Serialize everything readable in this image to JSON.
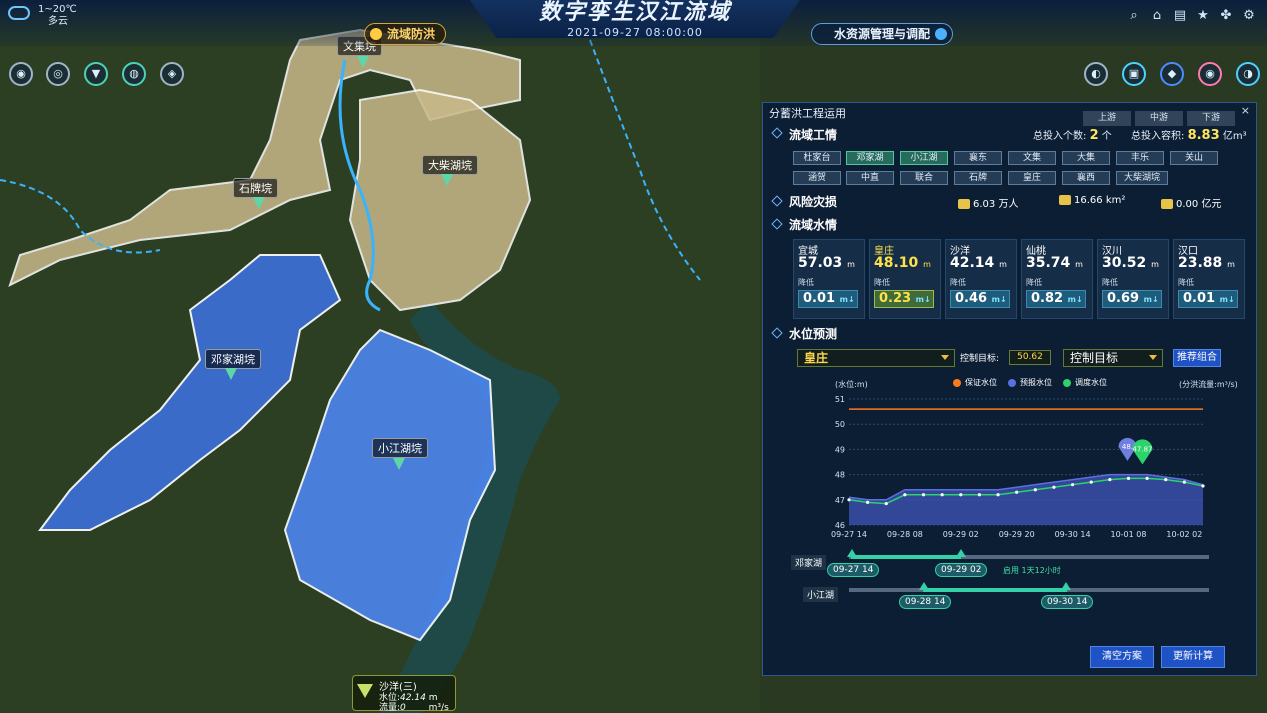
{
  "header": {
    "title": "数字孪生汉江流域",
    "datetime": "2021-09-27  08:00:00",
    "mode_left": "流域防洪",
    "mode_right": "水资源管理与调配"
  },
  "weather": {
    "temp": "1~20℃",
    "desc": "多云"
  },
  "top_icons": [
    "search-icon",
    "home-icon",
    "document-icon",
    "star-icon",
    "grid-icon",
    "gear-icon"
  ],
  "map": {
    "labels": [
      "文集垸",
      "大柴湖垸",
      "石牌垸",
      "邓家湖垸",
      "小江湖垸"
    ],
    "station": {
      "name": "沙洋(三)",
      "level_label": "水位:",
      "level": "42.14",
      "level_unit": "m",
      "flow_label": "流量:",
      "flow": "0",
      "flow_unit": "m³/s"
    }
  },
  "panel": {
    "title": "分蓄洪工程运用",
    "close": "×",
    "segments": [
      "上游",
      "中游",
      "下游"
    ],
    "sec1": {
      "title": "流域工情",
      "count_label": "总投入个数:",
      "count": "2",
      "count_unit": "个",
      "vol_label": "总投入容积:",
      "vol": "8.83",
      "vol_unit": "亿m³"
    },
    "chips": [
      "杜家台",
      "邓家湖",
      "小江湖",
      "襄东",
      "文集",
      "大集",
      "丰乐",
      "关山",
      "涵贺",
      "中直",
      "联合",
      "石牌",
      "皇庄",
      "襄西",
      "大柴湖垸"
    ],
    "sec2": {
      "title": "风险灾损",
      "pop": "6.03",
      "pop_unit": "万人",
      "area": "16.66",
      "area_unit": "km²",
      "loss": "0.00",
      "loss_unit": "亿元"
    },
    "sec3": {
      "title": "流域水情"
    },
    "stations": [
      {
        "name": "宜城",
        "level": "57.03",
        "unit": "m",
        "trend": "降低",
        "delta": "0.01"
      },
      {
        "name": "皇庄",
        "level": "48.10",
        "unit": "m",
        "trend": "降低",
        "delta": "0.23"
      },
      {
        "name": "沙洋",
        "level": "42.14",
        "unit": "m",
        "trend": "降低",
        "delta": "0.46"
      },
      {
        "name": "仙桃",
        "level": "35.74",
        "unit": "m",
        "trend": "降低",
        "delta": "0.82"
      },
      {
        "name": "汉川",
        "level": "30.52",
        "unit": "m",
        "trend": "降低",
        "delta": "0.69"
      },
      {
        "name": "汉口",
        "level": "23.88",
        "unit": "m",
        "trend": "降低",
        "delta": "0.01"
      }
    ],
    "sec4": {
      "title": "水位预测",
      "station_select": "皇庄",
      "ctl_label": "控制目标:",
      "ctl_value": "50.62",
      "target_select": "控制目标",
      "recommend": "推荐组合"
    },
    "legend": [
      "保证水位",
      "预报水位",
      "调度水位"
    ],
    "chart_labels": {
      "ylabel": "(水位:m)",
      "y2label": "(分洪流量:m³/s)",
      "pin1": "48.",
      "pin2": "47.87"
    },
    "gantt": [
      {
        "name": "邓家湖",
        "start": "09-27 14",
        "end": "09-29 02",
        "note": "启用 1天12小时"
      },
      {
        "name": "小江湖",
        "start": "09-28 14",
        "end": "09-30 14",
        "note": ""
      }
    ],
    "buttons": {
      "clear": "清空方案",
      "recalc": "更新计算"
    }
  },
  "chart_data": {
    "type": "line",
    "x": [
      "09-27 14",
      "09-27 20",
      "09-28 02",
      "09-28 08",
      "09-28 14",
      "09-28 20",
      "09-29 02",
      "09-29 08",
      "09-29 14",
      "09-29 20",
      "09-30 02",
      "09-30 08",
      "09-30 14",
      "09-30 20",
      "10-01 02",
      "10-01 08",
      "10-01 14",
      "10-01 20",
      "10-02 02",
      "10-02 08"
    ],
    "xticks": [
      "09-27 14",
      "09-28 08",
      "09-29 02",
      "09-29 20",
      "09-30 14",
      "10-01 08",
      "10-02 02"
    ],
    "ylim": [
      46,
      51
    ],
    "yticks": [
      46,
      47,
      48,
      49,
      50,
      51
    ],
    "ylabel": "(水位:m)",
    "series": [
      {
        "name": "保证水位",
        "color": "#ff7a1a",
        "values": [
          50.6,
          50.6,
          50.6,
          50.6,
          50.6,
          50.6,
          50.6,
          50.6,
          50.6,
          50.6,
          50.6,
          50.6,
          50.6,
          50.6,
          50.6,
          50.6,
          50.6,
          50.6,
          50.6,
          50.6
        ]
      },
      {
        "name": "预报水位",
        "color": "#5a6fe0",
        "values": [
          47.1,
          47.0,
          47.0,
          47.4,
          47.4,
          47.4,
          47.4,
          47.4,
          47.4,
          47.5,
          47.6,
          47.7,
          47.8,
          47.9,
          48.0,
          48.0,
          48.0,
          47.9,
          47.8,
          47.6
        ]
      },
      {
        "name": "调度水位",
        "color": "#2bd36a",
        "values": [
          47.0,
          46.9,
          46.85,
          47.2,
          47.2,
          47.2,
          47.2,
          47.2,
          47.2,
          47.3,
          47.4,
          47.5,
          47.6,
          47.7,
          47.8,
          47.85,
          47.85,
          47.8,
          47.7,
          47.55
        ]
      }
    ]
  }
}
